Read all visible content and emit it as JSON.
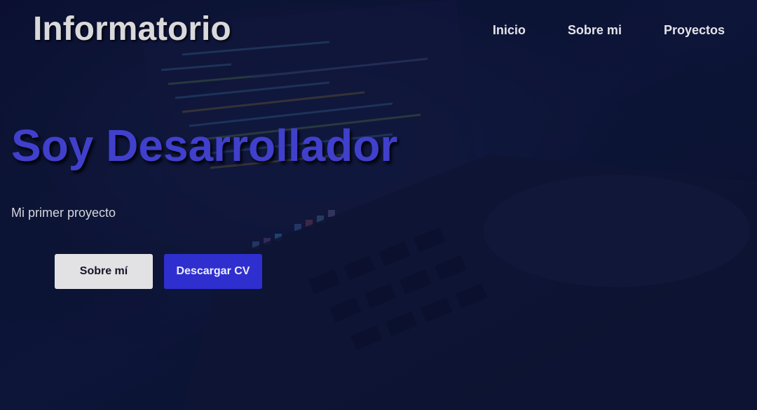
{
  "header": {
    "brand": "Informatorio",
    "nav": [
      {
        "label": "Inicio"
      },
      {
        "label": "Sobre mi"
      },
      {
        "label": "Proyectos"
      }
    ]
  },
  "hero": {
    "title": "Soy Desarrollador",
    "subtitle": "Mi primer proyecto",
    "buttons": {
      "about_label": "Sobre mí",
      "cv_label": "Descargar CV"
    }
  },
  "colors": {
    "background": "#0b1030",
    "title_accent": "#4040cc",
    "primary_button": "#2f2fcf",
    "secondary_button": "#e2e2e4"
  }
}
